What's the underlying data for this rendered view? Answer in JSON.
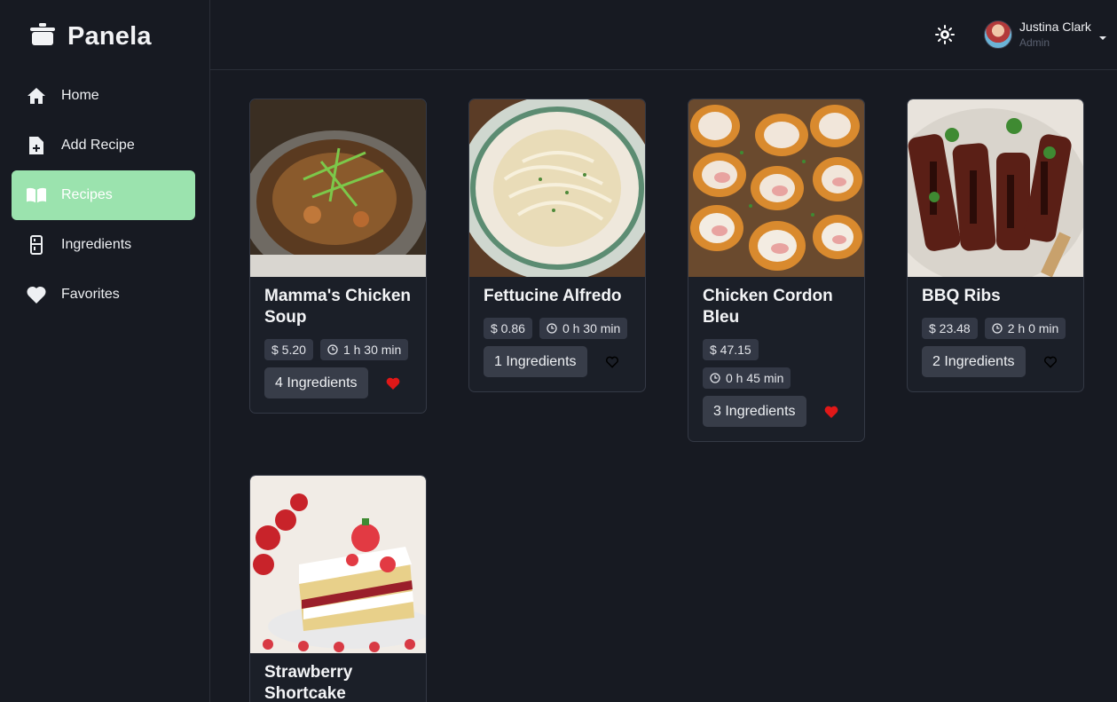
{
  "brand": {
    "name": "Panela",
    "icon": "pot-icon"
  },
  "sidebar": {
    "items": [
      {
        "label": "Home",
        "icon": "home-icon",
        "active": false
      },
      {
        "label": "Add Recipe",
        "icon": "file-plus-icon",
        "active": false
      },
      {
        "label": "Recipes",
        "icon": "book-icon",
        "active": true
      },
      {
        "label": "Ingredients",
        "icon": "fridge-icon",
        "active": false
      },
      {
        "label": "Favorites",
        "icon": "heart-icon",
        "active": false
      }
    ]
  },
  "header": {
    "theme_icon": "sun-icon",
    "user": {
      "name": "Justina Clark",
      "role": "Admin"
    }
  },
  "colors": {
    "accent": "#9be3ae",
    "favorite": "#e01818",
    "background": "#171a22"
  },
  "recipes": [
    {
      "title": "Mamma's Chicken Soup",
      "price": "$ 5.20",
      "time": "1 h 30 min",
      "ingredients": "4 Ingredients",
      "favorite": true
    },
    {
      "title": "Fettucine Alfredo",
      "price": "$ 0.86",
      "time": "0 h 30 min",
      "ingredients": "1 Ingredients",
      "favorite": false
    },
    {
      "title": "Chicken Cordon Bleu",
      "price": "$ 47.15",
      "time": "0 h 45 min",
      "ingredients": "3 Ingredients",
      "favorite": true
    },
    {
      "title": "BBQ Ribs",
      "price": "$ 23.48",
      "time": "2 h 0 min",
      "ingredients": "2 Ingredients",
      "favorite": false
    },
    {
      "title": "Strawberry Shortcake",
      "price": "",
      "time": "",
      "ingredients": "",
      "favorite": false
    }
  ]
}
